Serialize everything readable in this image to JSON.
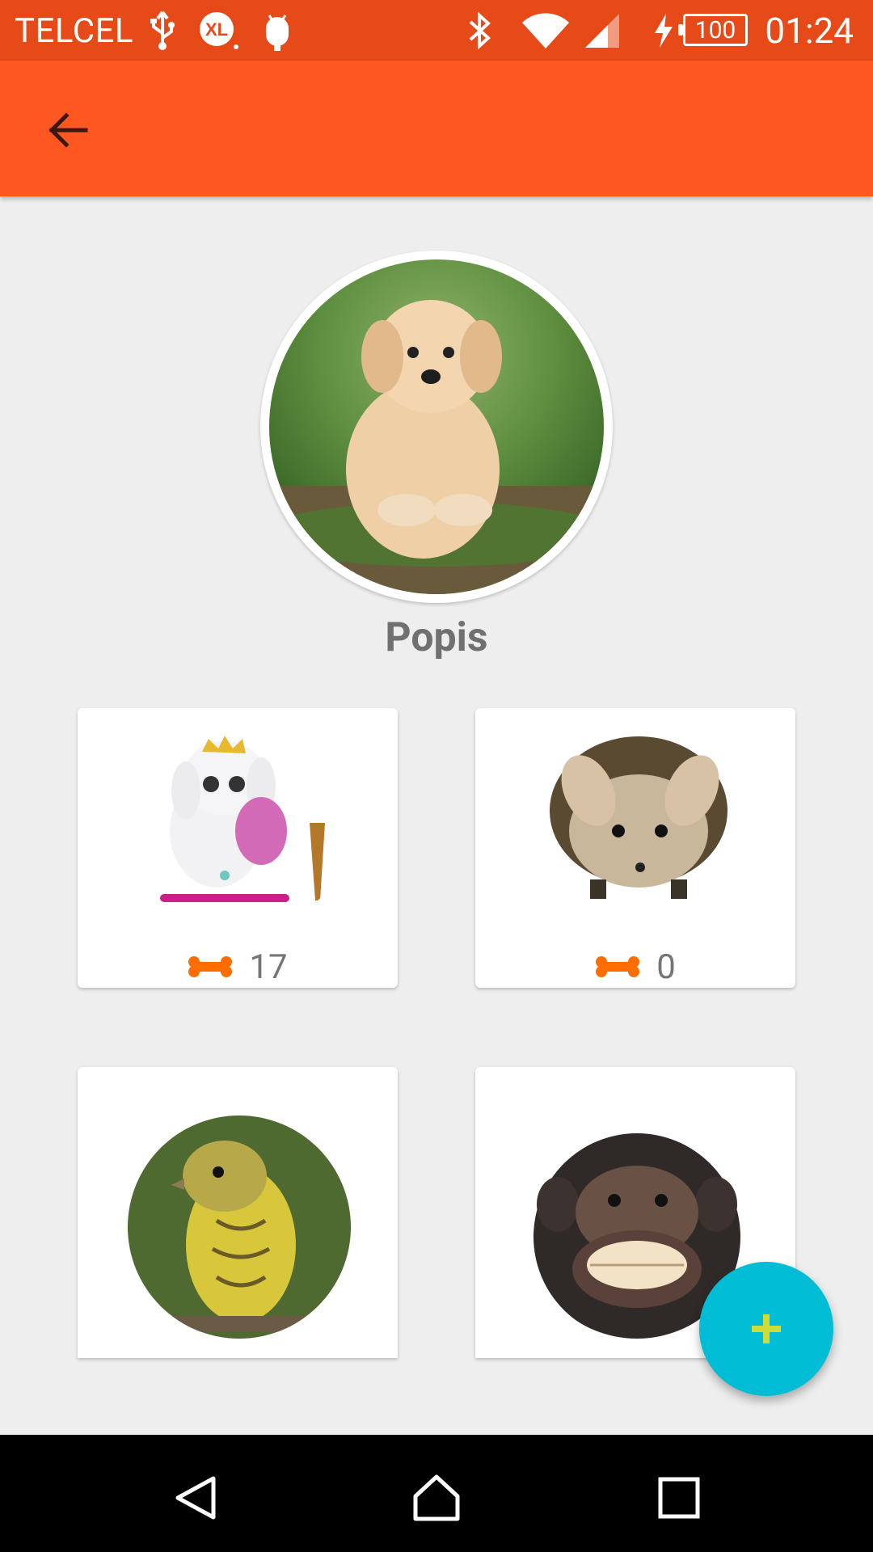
{
  "status_bar": {
    "carrier": "TELCEL",
    "battery_level": "100",
    "time": "01:24",
    "icons": [
      "usb-icon",
      "xl-icon",
      "android-debug-icon",
      "bluetooth-icon",
      "wifi-icon",
      "cell-signal-icon",
      "charging-icon",
      "battery-icon"
    ]
  },
  "app_bar": {
    "back_icon": "arrow-back-icon"
  },
  "profile": {
    "name": "Popis",
    "avatar": "puppy-photo"
  },
  "cards": [
    {
      "image": "toy-dog-image",
      "count": "17",
      "icon": "bone-icon"
    },
    {
      "image": "hedgehog-image",
      "count": "0",
      "icon": "bone-icon"
    },
    {
      "image": "bird-image"
    },
    {
      "image": "chimpanzee-image"
    }
  ],
  "fab": {
    "icon": "plus-icon",
    "color": "#00bcd4",
    "plus_color": "#cddc39"
  },
  "nav_bar": {
    "icons": [
      "nav-back-icon",
      "nav-home-icon",
      "nav-recents-icon"
    ]
  },
  "colors": {
    "status_bar": "#e64a19",
    "app_bar": "#ff5722",
    "background": "#eeeeee",
    "bone": "#ff6d00"
  }
}
